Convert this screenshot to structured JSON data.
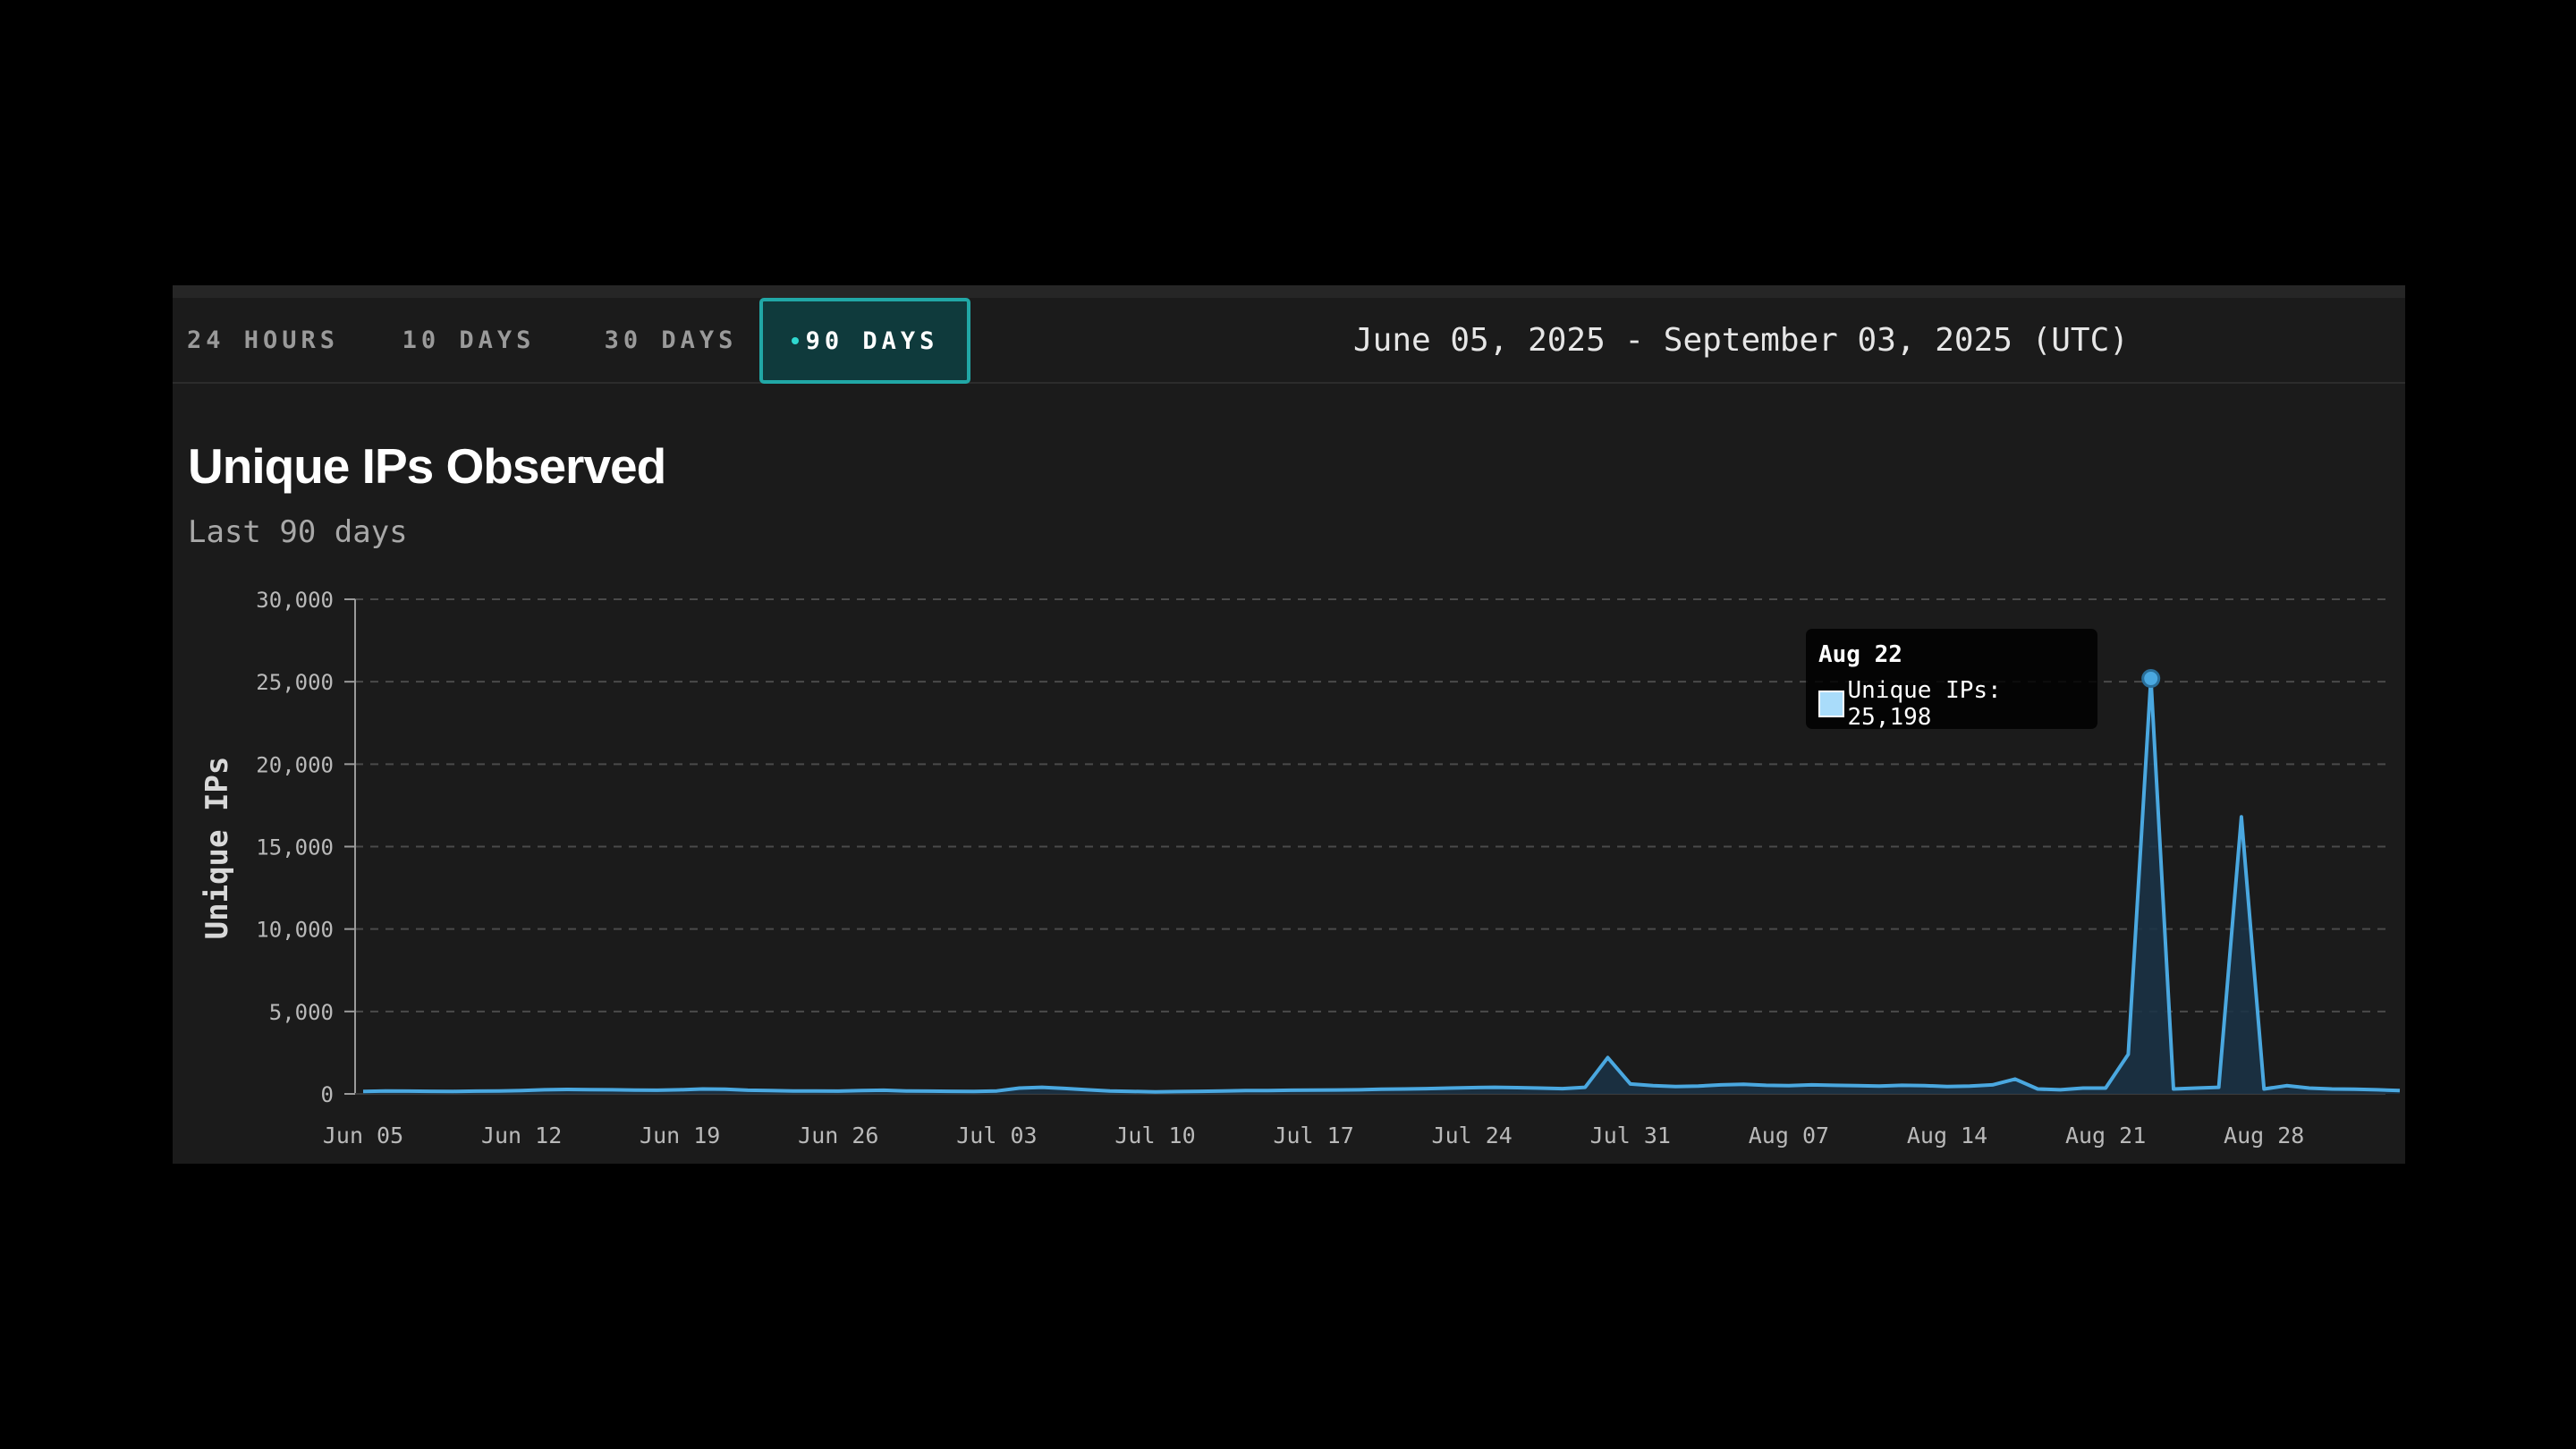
{
  "tabs": [
    {
      "label": "24 HOURS",
      "active": false
    },
    {
      "label": "10 DAYS",
      "active": false
    },
    {
      "label": "30 DAYS",
      "active": false
    },
    {
      "label": "90 DAYS",
      "active": true
    }
  ],
  "date_range": "June 05, 2025 - September 03, 2025 (UTC)",
  "colors": {
    "accent": "#21a7a6",
    "line": "#4aa8e0",
    "fill": "#1a3347",
    "grid": "#4a4a4a",
    "axis_text": "#b9b9b9"
  },
  "chart_data": {
    "type": "area",
    "title": "Unique IPs Observed",
    "subtitle": "Last 90 days",
    "xlabel": "",
    "ylabel": "Unique IPs",
    "ylim": [
      0,
      30000
    ],
    "yticks": [
      0,
      5000,
      10000,
      15000,
      20000,
      25000,
      30000
    ],
    "ytick_labels": [
      "0",
      "5,000",
      "10,000",
      "15,000",
      "20,000",
      "25,000",
      "30,000"
    ],
    "grid": true,
    "x_start": "2025-06-05",
    "xtick_labels": [
      "Jun 05",
      "Jun 12",
      "Jun 19",
      "Jun 26",
      "Jul 03",
      "Jul 10",
      "Jul 17",
      "Jul 24",
      "Jul 31",
      "Aug 07",
      "Aug 14",
      "Aug 21",
      "Aug 28"
    ],
    "series": [
      {
        "name": "Unique IPs",
        "values": [
          150,
          180,
          170,
          160,
          150,
          170,
          180,
          200,
          250,
          270,
          260,
          250,
          230,
          220,
          250,
          300,
          280,
          220,
          200,
          180,
          180,
          170,
          200,
          220,
          180,
          170,
          160,
          150,
          180,
          350,
          400,
          330,
          250,
          180,
          150,
          120,
          140,
          160,
          180,
          200,
          200,
          220,
          230,
          240,
          250,
          280,
          300,
          320,
          350,
          380,
          400,
          380,
          350,
          320,
          400,
          2200,
          600,
          500,
          450,
          480,
          550,
          580,
          520,
          500,
          550,
          520,
          500,
          480,
          520,
          500,
          450,
          480,
          550,
          900,
          300,
          250,
          350,
          350,
          2400,
          25198,
          300,
          350,
          400,
          16800,
          300,
          500,
          350,
          300,
          280,
          250,
          200
        ]
      }
    ],
    "tooltip": {
      "title": "Aug 22",
      "label": "Unique IPs: 25,198"
    }
  }
}
